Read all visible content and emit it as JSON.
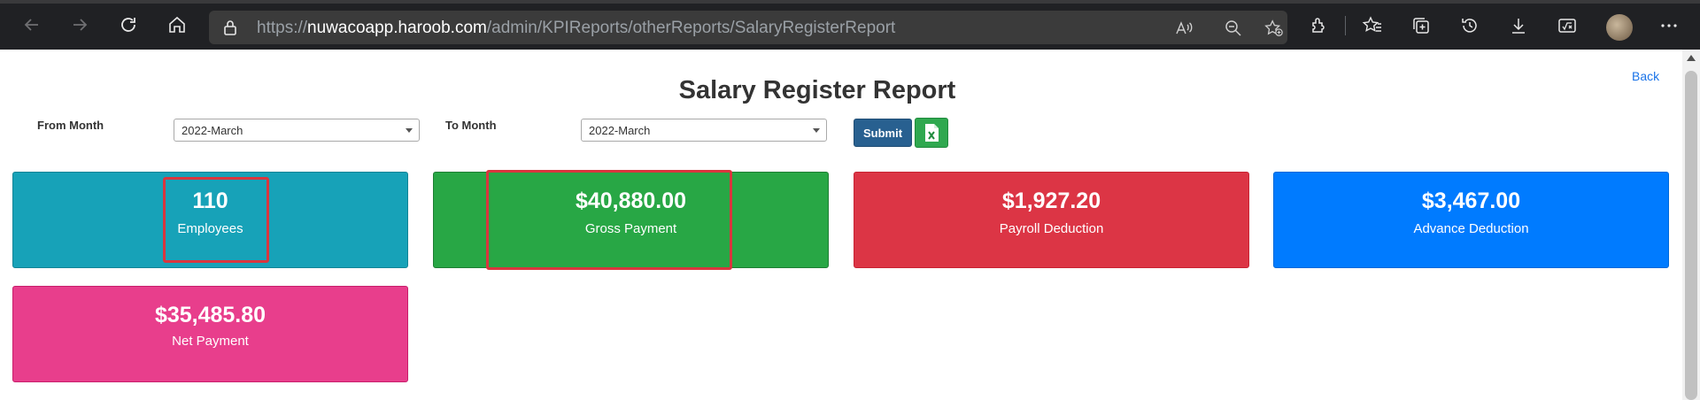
{
  "browser": {
    "url_prefix": "https://",
    "url_host": "nuwacoapp.haroob.com",
    "url_path": "/admin/KPIReports/otherReports/SalaryRegisterReport",
    "icons": [
      "back-icon",
      "forward-icon",
      "refresh-icon",
      "home-icon",
      "lock-icon",
      "read-aloud-icon",
      "zoom-out-icon",
      "add-favorite-icon",
      "extensions-icon",
      "favorites-icon",
      "collections-icon",
      "history-icon",
      "downloads-icon",
      "math-solver-icon",
      "profile-avatar",
      "more-icon"
    ]
  },
  "page": {
    "title": "Salary Register Report",
    "back_label": "Back"
  },
  "filters": {
    "from_label": "From Month",
    "from_value": "2022-March",
    "to_label": "To Month",
    "to_value": "2022-March",
    "submit_label": "Submit",
    "excel_icon": "excel-icon"
  },
  "cards": {
    "employees": {
      "value": "110",
      "label": "Employees",
      "color": "#17a2b8"
    },
    "gross": {
      "value": "$40,880.00",
      "label": "Gross Payment",
      "color": "#28a745"
    },
    "payroll": {
      "value": "$1,927.20",
      "label": "Payroll Deduction",
      "color": "#dc3545"
    },
    "advance": {
      "value": "$3,467.00",
      "label": "Advance Deduction",
      "color": "#007bff"
    },
    "net": {
      "value": "$35,485.80",
      "label": "Net Payment",
      "color": "#e83e8c"
    }
  },
  "highlight_color": "#d9363e"
}
